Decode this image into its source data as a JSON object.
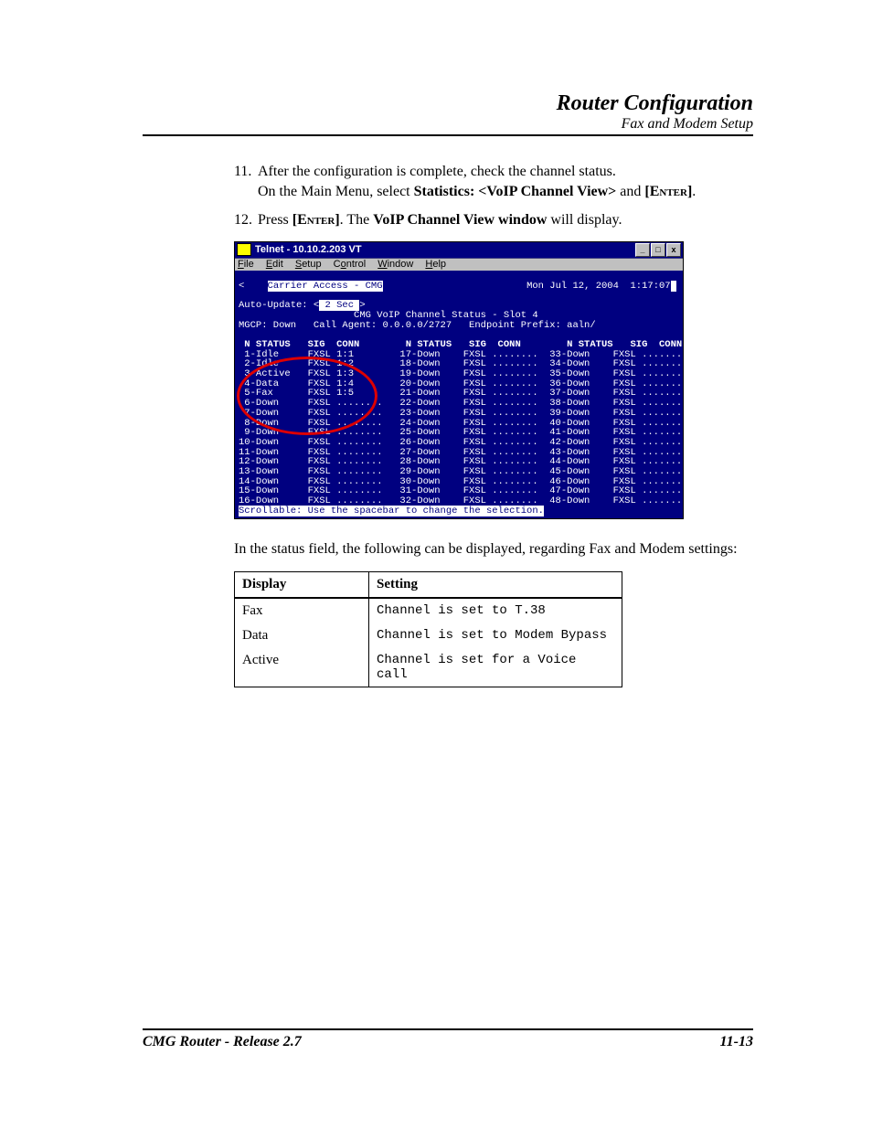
{
  "header": {
    "title": "Router Configuration",
    "subtitle": "Fax and Modem Setup"
  },
  "steps": {
    "s11_num": "11.",
    "s11_line1": "After the configuration is complete, check the channel status.",
    "s11_line2a": "On the Main Menu, select ",
    "s11_line2b": "Statistics: <VoIP Channel View>",
    "s11_line2c": " and ",
    "s11_line2d": "[Enter]",
    "s11_line2e": ".",
    "s12_num": "12.",
    "s12_a": "Press ",
    "s12_b": "[Enter]",
    "s12_c": ". The ",
    "s12_d": "VoIP Channel View window",
    "s12_e": " will display."
  },
  "telnet": {
    "title": "Telnet - 10.10.2.203 VT",
    "menus": {
      "file": "File",
      "edit": "Edit",
      "setup": "Setup",
      "control": "Control",
      "window": "Window",
      "help": "Help"
    },
    "topline_left": "Carrier Access - CMG",
    "topline_right": "Mon Jul 12, 2004  1:17:07",
    "auto_update_label": "Auto-Update: <",
    "auto_update_val": " 2 Sec ",
    "auto_update_end": ">",
    "heading": "CMG VoIP Channel Status - Slot 4",
    "mgcp_line": "MGCP: Down   Call Agent: 0.0.0.0/2727   Endpoint Prefix: aaln/",
    "colhdr": " N STATUS   SIG  CONN        N STATUS   SIG  CONN        N STATUS   SIG  CONN",
    "rows": [
      " 1-Idle     FXSL 1:1        17-Down    FXSL ........  33-Down    FXSL ........",
      " 2-Idle     FXSL 1:2        18-Down    FXSL ........  34-Down    FXSL ........",
      " 3-Active   FXSL 1:3        19-Down    FXSL ........  35-Down    FXSL ........",
      " 4-Data     FXSL 1:4        20-Down    FXSL ........  36-Down    FXSL ........",
      " 5-Fax      FXSL 1:5        21-Down    FXSL ........  37-Down    FXSL ........",
      " 6-Down     FXSL ........   22-Down    FXSL ........  38-Down    FXSL ........",
      " 7-Down     FXSL ........   23-Down    FXSL ........  39-Down    FXSL ........",
      " 8-Down     FXSL ........   24-Down    FXSL ........  40-Down    FXSL ........",
      " 9-Down     FXSL ........   25-Down    FXSL ........  41-Down    FXSL ........",
      "10-Down     FXSL ........   26-Down    FXSL ........  42-Down    FXSL ........",
      "11-Down     FXSL ........   27-Down    FXSL ........  43-Down    FXSL ........",
      "12-Down     FXSL ........   28-Down    FXSL ........  44-Down    FXSL ........",
      "13-Down     FXSL ........   29-Down    FXSL ........  45-Down    FXSL ........",
      "14-Down     FXSL ........   30-Down    FXSL ........  46-Down    FXSL ........",
      "15-Down     FXSL ........   31-Down    FXSL ........  47-Down    FXSL ........",
      "16-Down     FXSL ........   32-Down    FXSL ........  48-Down    FXSL ........"
    ],
    "footer": "Scrollable: Use the spacebar to change the selection."
  },
  "status_para": "In the status field, the following can be displayed, regarding Fax and Modem settings:",
  "table": {
    "h1": "Display",
    "h2": "Setting",
    "rows": [
      {
        "d": "Fax",
        "s": "Channel is set to T.38"
      },
      {
        "d": "Data",
        "s": "Channel is set to Modem Bypass"
      },
      {
        "d": "Active",
        "s": "Channel is set for a Voice call"
      }
    ]
  },
  "footer": {
    "left": "CMG Router - Release 2.7",
    "right": "11-13"
  }
}
